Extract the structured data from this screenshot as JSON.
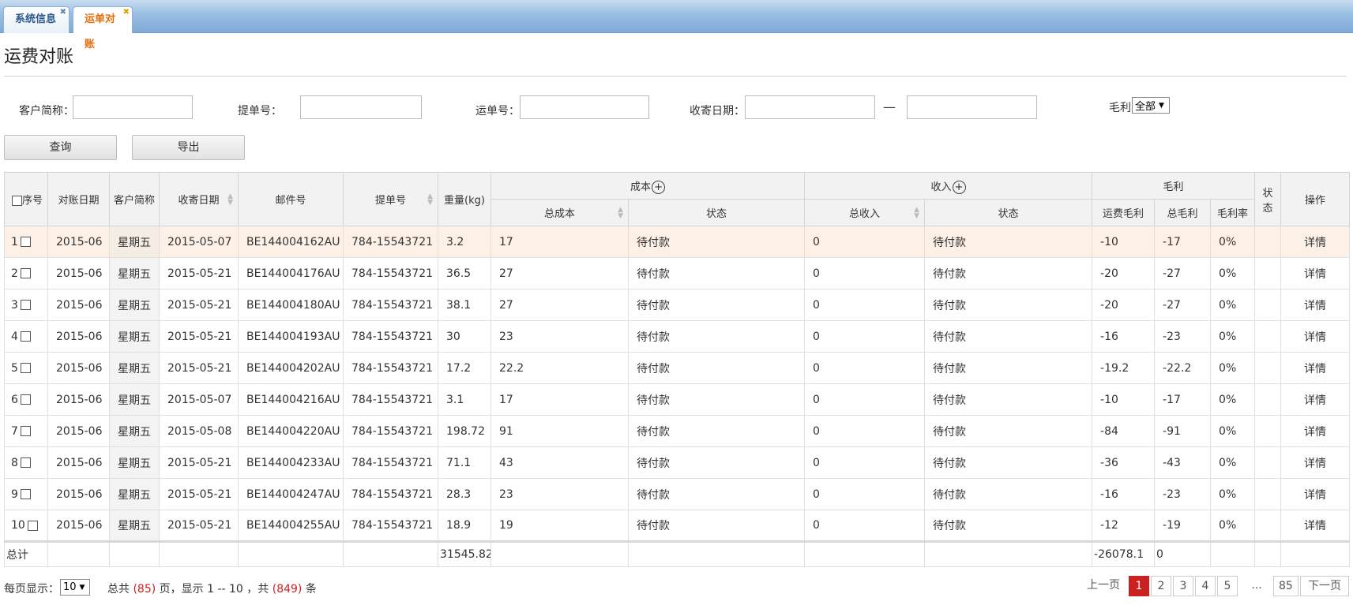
{
  "tabs": [
    {
      "label": "系统信息"
    },
    {
      "label": "运单对账"
    }
  ],
  "page_title": "运费对账",
  "filters": {
    "customer_label": "客户简称：",
    "bill_label": "提单号：",
    "waybill_label": "运单号：",
    "date_label": "收寄日期：",
    "date_separator": "—",
    "profit_label": "毛利",
    "profit_value": "全部"
  },
  "buttons": {
    "query": "查询",
    "export": "导出"
  },
  "columns": {
    "seq": "序号",
    "recon_date": "对账日期",
    "customer": "客户简称",
    "send_date": "收寄日期",
    "mail_no": "邮件号",
    "bill_no": "提单号",
    "weight": "重量(kg)",
    "cost": "成本",
    "cost_total": "总成本",
    "cost_status": "状态",
    "income": "收入",
    "income_total": "总收入",
    "income_status": "状态",
    "profit": "毛利",
    "freight_profit": "运费毛利",
    "total_profit": "总毛利",
    "profit_rate": "毛利率",
    "status": "状态",
    "action": "操作"
  },
  "rows": [
    {
      "seq": "1",
      "recon_date": "2015-06",
      "customer": "星期五",
      "send_date": "2015-05-07",
      "mail_no": "BE144004162AU",
      "bill_no": "784-15543721",
      "weight": "3.2",
      "cost_total": "17",
      "cost_status": "待付款",
      "income_total": "0",
      "income_status": "待付款",
      "freight_profit": "-10",
      "total_profit": "-17",
      "profit_rate": "0%",
      "action": "详情"
    },
    {
      "seq": "2",
      "recon_date": "2015-06",
      "customer": "星期五",
      "send_date": "2015-05-21",
      "mail_no": "BE144004176AU",
      "bill_no": "784-15543721",
      "weight": "36.5",
      "cost_total": "27",
      "cost_status": "待付款",
      "income_total": "0",
      "income_status": "待付款",
      "freight_profit": "-20",
      "total_profit": "-27",
      "profit_rate": "0%",
      "action": "详情"
    },
    {
      "seq": "3",
      "recon_date": "2015-06",
      "customer": "星期五",
      "send_date": "2015-05-21",
      "mail_no": "BE144004180AU",
      "bill_no": "784-15543721",
      "weight": "38.1",
      "cost_total": "27",
      "cost_status": "待付款",
      "income_total": "0",
      "income_status": "待付款",
      "freight_profit": "-20",
      "total_profit": "-27",
      "profit_rate": "0%",
      "action": "详情"
    },
    {
      "seq": "4",
      "recon_date": "2015-06",
      "customer": "星期五",
      "send_date": "2015-05-21",
      "mail_no": "BE144004193AU",
      "bill_no": "784-15543721",
      "weight": "30",
      "cost_total": "23",
      "cost_status": "待付款",
      "income_total": "0",
      "income_status": "待付款",
      "freight_profit": "-16",
      "total_profit": "-23",
      "profit_rate": "0%",
      "action": "详情"
    },
    {
      "seq": "5",
      "recon_date": "2015-06",
      "customer": "星期五",
      "send_date": "2015-05-21",
      "mail_no": "BE144004202AU",
      "bill_no": "784-15543721",
      "weight": "17.2",
      "cost_total": "22.2",
      "cost_status": "待付款",
      "income_total": "0",
      "income_status": "待付款",
      "freight_profit": "-19.2",
      "total_profit": "-22.2",
      "profit_rate": "0%",
      "action": "详情"
    },
    {
      "seq": "6",
      "recon_date": "2015-06",
      "customer": "星期五",
      "send_date": "2015-05-07",
      "mail_no": "BE144004216AU",
      "bill_no": "784-15543721",
      "weight": "3.1",
      "cost_total": "17",
      "cost_status": "待付款",
      "income_total": "0",
      "income_status": "待付款",
      "freight_profit": "-10",
      "total_profit": "-17",
      "profit_rate": "0%",
      "action": "详情"
    },
    {
      "seq": "7",
      "recon_date": "2015-06",
      "customer": "星期五",
      "send_date": "2015-05-08",
      "mail_no": "BE144004220AU",
      "bill_no": "784-15543721",
      "weight": "198.72",
      "cost_total": "91",
      "cost_status": "待付款",
      "income_total": "0",
      "income_status": "待付款",
      "freight_profit": "-84",
      "total_profit": "-91",
      "profit_rate": "0%",
      "action": "详情"
    },
    {
      "seq": "8",
      "recon_date": "2015-06",
      "customer": "星期五",
      "send_date": "2015-05-21",
      "mail_no": "BE144004233AU",
      "bill_no": "784-15543721",
      "weight": "71.1",
      "cost_total": "43",
      "cost_status": "待付款",
      "income_total": "0",
      "income_status": "待付款",
      "freight_profit": "-36",
      "total_profit": "-43",
      "profit_rate": "0%",
      "action": "详情"
    },
    {
      "seq": "9",
      "recon_date": "2015-06",
      "customer": "星期五",
      "send_date": "2015-05-21",
      "mail_no": "BE144004247AU",
      "bill_no": "784-15543721",
      "weight": "28.3",
      "cost_total": "23",
      "cost_status": "待付款",
      "income_total": "0",
      "income_status": "待付款",
      "freight_profit": "-16",
      "total_profit": "-23",
      "profit_rate": "0%",
      "action": "详情"
    },
    {
      "seq": "10",
      "recon_date": "2015-06",
      "customer": "星期五",
      "send_date": "2015-05-21",
      "mail_no": "BE144004255AU",
      "bill_no": "784-15543721",
      "weight": "18.9",
      "cost_total": "19",
      "cost_status": "待付款",
      "income_total": "0",
      "income_status": "待付款",
      "freight_profit": "-12",
      "total_profit": "-19",
      "profit_rate": "0%",
      "action": "详情"
    }
  ],
  "totals": {
    "label": "总计",
    "weight": "31545.82",
    "freight_profit": "-26078.1",
    "total_profit": "0"
  },
  "footer": {
    "per_page_label": "每页显示：",
    "per_page_value": "10",
    "summary_a": "总共",
    "total_pages": "(85)",
    "summary_b": "页，显示 1 -- 10 ，共",
    "total_records": "(849)",
    "summary_c": "条"
  },
  "pagination": {
    "prev": "上一页",
    "pages": [
      "1",
      "2",
      "3",
      "4",
      "5"
    ],
    "ellipsis": "...",
    "last": "85",
    "next": "下一页"
  },
  "colors": {
    "accent_red": "#cc1f1f",
    "link_blue": "#2e7fc7",
    "tab_active": "#e36c09"
  }
}
